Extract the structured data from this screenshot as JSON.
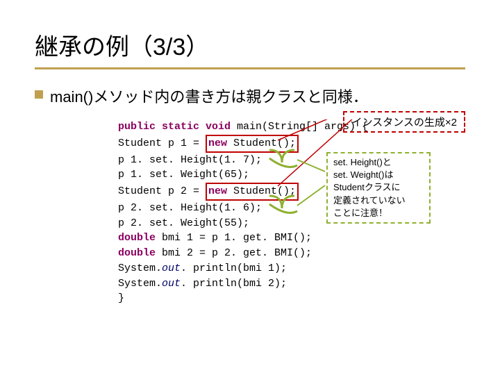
{
  "title": "継承の例（3/3）",
  "subtitle": "main()メソッド内の書き方は親クラスと同様．",
  "callout1": "インスタンスの生成×2",
  "callout2_l1": "set. Height()と",
  "callout2_l2": "set. Weight()は",
  "callout2_l3": "Studentクラスに",
  "callout2_l4": "定義されていない",
  "callout2_l5": "ことに注意！",
  "code": {
    "l1a": "public static void",
    "l1b": " main(String[] args) {",
    "l2a": "    Student p 1 = ",
    "l2b": "new",
    "l2c": " Student();",
    "l3": "    p 1. set. Height(1. 7);",
    "l4": "    p 1. set. Weight(65);",
    "l5a": "    Student p 2 = ",
    "l5b": "new",
    "l5c": " Student();",
    "l6": "    p 2. set. Height(1. 6);",
    "l7": "    p 2. set. Weight(55);",
    "l8a": "    ",
    "l8b": "double",
    "l8c": " bmi 1 = p 1. get. BMI();",
    "l9a": "    ",
    "l9b": "double",
    "l9c": " bmi 2 = p 2. get. BMI();",
    "l10a": "    System.",
    "l10b": "out",
    "l10c": ". println(bmi 1);",
    "l11a": "    System.",
    "l11b": "out",
    "l11c": ". println(bmi 2);",
    "l12": "}"
  }
}
